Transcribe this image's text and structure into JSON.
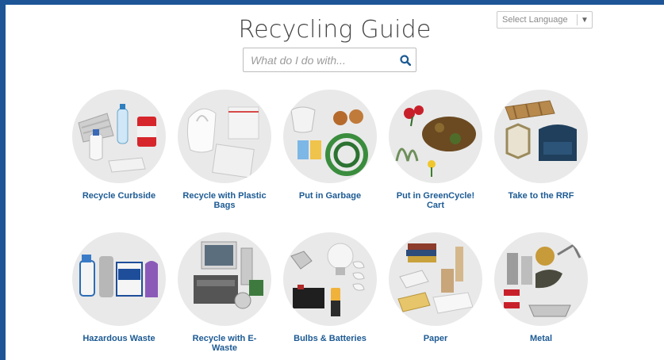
{
  "page": {
    "title": "Recycling Guide"
  },
  "language": {
    "selected": "Select Language",
    "arrow": "▼"
  },
  "search": {
    "placeholder": "What do I do with..."
  },
  "categories": [
    {
      "label": "Recycle Curbside",
      "icon": "recycle-curbside-icon"
    },
    {
      "label": "Recycle with Plastic Bags",
      "icon": "plastic-bags-icon"
    },
    {
      "label": "Put in Garbage",
      "icon": "garbage-icon"
    },
    {
      "label": "Put in GreenCycle! Cart",
      "icon": "greencycle-icon"
    },
    {
      "label": "Take to the RRF",
      "icon": "rrf-icon"
    },
    {
      "label": "Hazardous Waste",
      "icon": "hazardous-waste-icon"
    },
    {
      "label": "Recycle with E-Waste",
      "icon": "e-waste-icon"
    },
    {
      "label": "Bulbs & Batteries",
      "icon": "bulbs-batteries-icon"
    },
    {
      "label": "Paper",
      "icon": "paper-icon"
    },
    {
      "label": "Metal",
      "icon": "metal-icon"
    }
  ],
  "colors": {
    "frame": "#1d5597",
    "link": "#1c5a93",
    "circle": "#e9e9e9"
  }
}
